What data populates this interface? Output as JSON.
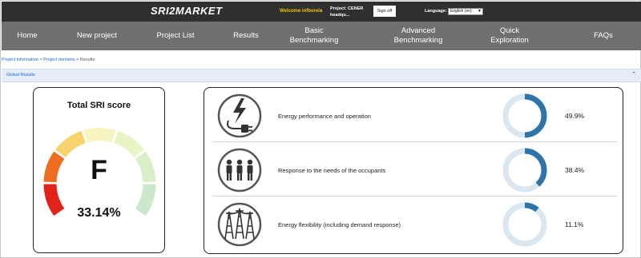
{
  "header": {
    "logo": "SRI2MARKET",
    "welcome": "Welcome infborela",
    "separator": "-",
    "project": "Project: CENER headqu...",
    "sign_off": "Sign off",
    "language_label": "Language:",
    "language_value": "English (en)"
  },
  "nav": {
    "items": [
      {
        "label": "Home"
      },
      {
        "label": "New project"
      },
      {
        "label": "Project List"
      },
      {
        "label": "Results"
      },
      {
        "label_line1": "Basic",
        "label_line2": "Benchmarking"
      },
      {
        "label_line1": "Advanced",
        "label_line2": "Benchmarking"
      },
      {
        "label_line1": "Quick",
        "label_line2": "Exploration"
      },
      {
        "label": "FAQs"
      }
    ]
  },
  "breadcrumb": {
    "items": [
      "Project information",
      "Project domains",
      "Results"
    ],
    "separator": ">"
  },
  "section": {
    "title": "Global Results"
  },
  "score": {
    "title": "Total SRI score",
    "grade": "F",
    "value": "33.14%",
    "gauge_colors": [
      "#e32219",
      "#ee6d20",
      "#f6d36d",
      "#f8f4bf",
      "#e8f4c5",
      "#d8efc8",
      "#cce8cc"
    ]
  },
  "domains": [
    {
      "label": "Energy performance and operation",
      "percent": "49.9%",
      "fraction": 0.499,
      "icon": "energy-plug-icon"
    },
    {
      "label": "Response to the needs of the occupants",
      "percent": "38.4%",
      "fraction": 0.384,
      "icon": "occupants-icon"
    },
    {
      "label": "Energy flexibility (including demand response)",
      "percent": "11.1%",
      "fraction": 0.111,
      "icon": "power-tower-icon"
    }
  ],
  "colors": {
    "ring_fill": "#2e74a8",
    "ring_track": "#dae6f0",
    "link": "#1a66d2",
    "welcome": "#f2c200"
  }
}
